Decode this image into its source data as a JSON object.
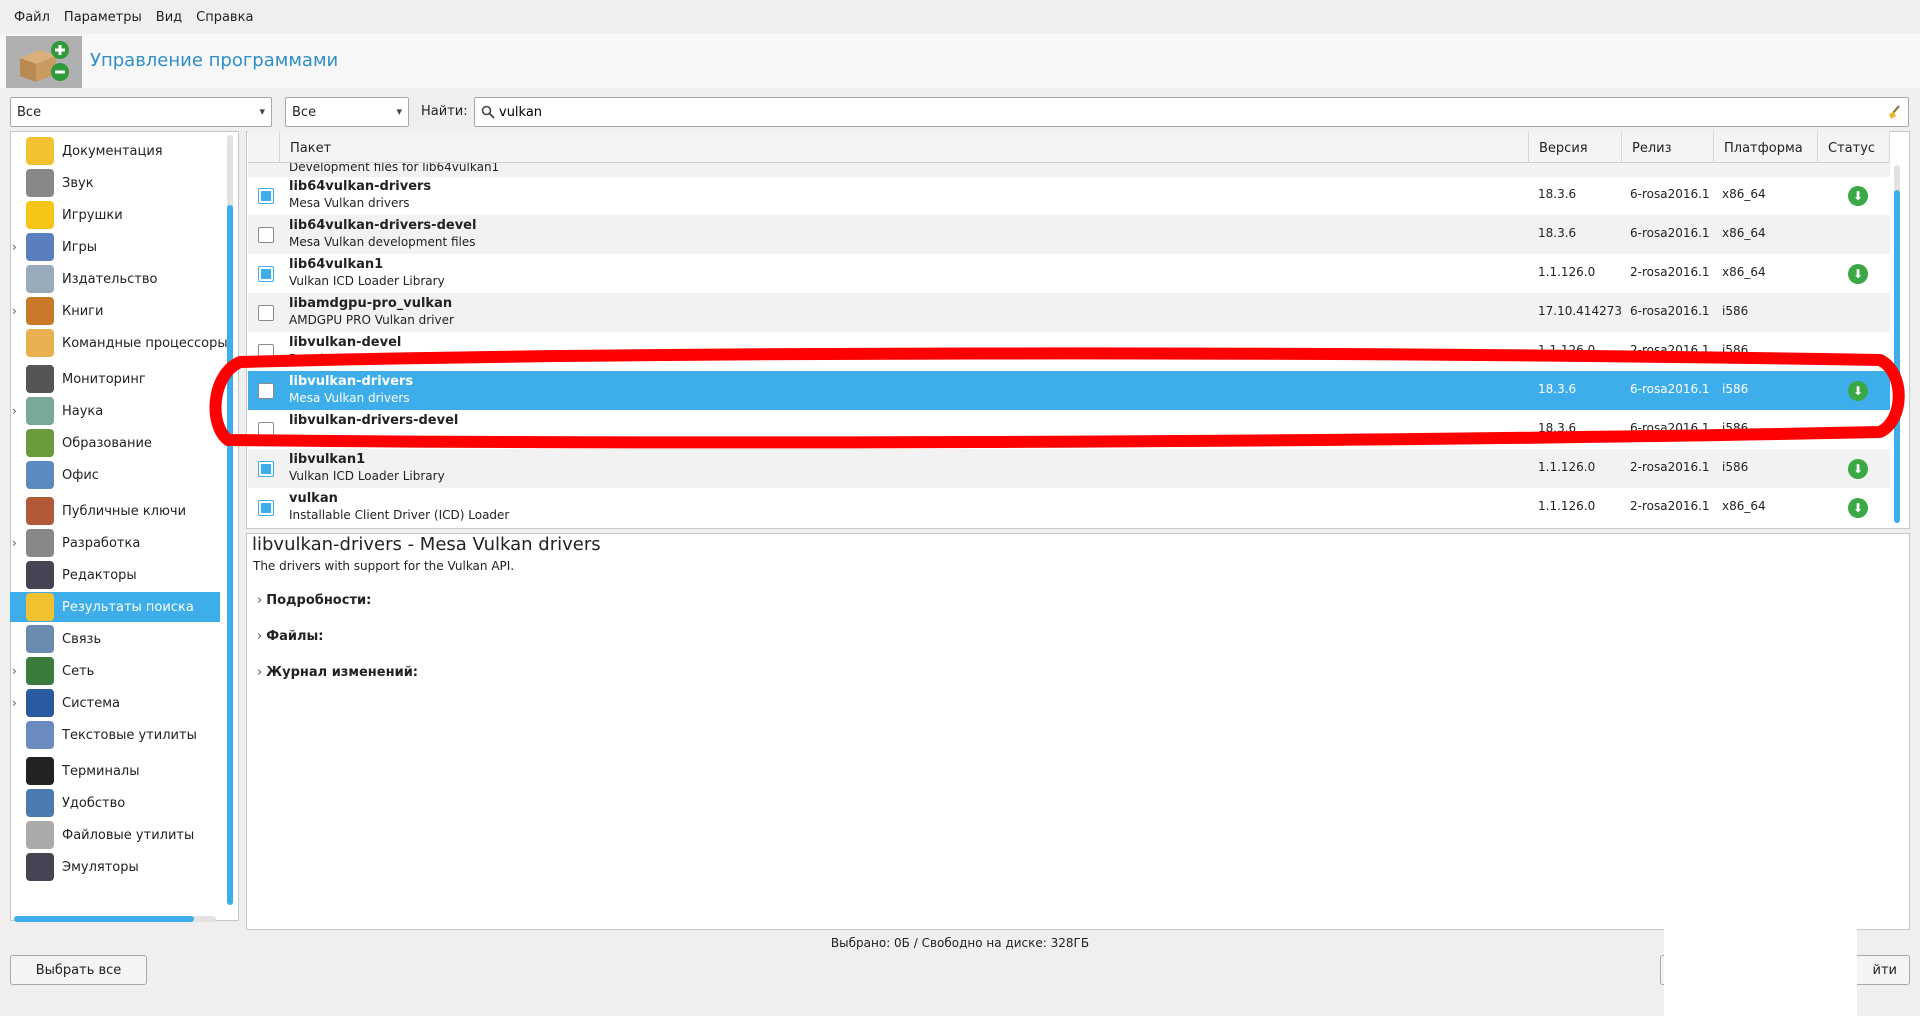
{
  "menu": {
    "file": "Файл",
    "params": "Параметры",
    "view": "Вид",
    "help": "Справка"
  },
  "banner": {
    "title": "Управление программами"
  },
  "filters": {
    "category_value": "Все",
    "status_value": "Все",
    "search_label": "Найти:",
    "search_value": "vulkan"
  },
  "categories": [
    {
      "label": "Документация",
      "expandable": false,
      "selected": false
    },
    {
      "label": "Звук",
      "expandable": false,
      "selected": false
    },
    {
      "label": "Игрушки",
      "expandable": false,
      "selected": false
    },
    {
      "label": "Игры",
      "expandable": true,
      "selected": false
    },
    {
      "label": "Издательство",
      "expandable": false,
      "selected": false
    },
    {
      "label": "Книги",
      "expandable": true,
      "selected": false
    },
    {
      "label": "Командные процессоры",
      "expandable": false,
      "selected": false
    },
    {
      "label": "Мониторинг",
      "expandable": false,
      "selected": false
    },
    {
      "label": "Наука",
      "expandable": true,
      "selected": false
    },
    {
      "label": "Образование",
      "expandable": false,
      "selected": false
    },
    {
      "label": "Офис",
      "expandable": false,
      "selected": false
    },
    {
      "label": "Публичные ключи",
      "expandable": false,
      "selected": false
    },
    {
      "label": "Разработка",
      "expandable": true,
      "selected": false
    },
    {
      "label": "Редакторы",
      "expandable": false,
      "selected": false
    },
    {
      "label": "Результаты поиска",
      "expandable": false,
      "selected": true
    },
    {
      "label": "Связь",
      "expandable": false,
      "selected": false
    },
    {
      "label": "Сеть",
      "expandable": true,
      "selected": false
    },
    {
      "label": "Система",
      "expandable": true,
      "selected": false
    },
    {
      "label": "Текстовые утилиты",
      "expandable": false,
      "selected": false
    },
    {
      "label": "Терминалы",
      "expandable": false,
      "selected": false
    },
    {
      "label": "Удобство",
      "expandable": false,
      "selected": false
    },
    {
      "label": "Файловые утилиты",
      "expandable": false,
      "selected": false
    },
    {
      "label": "Эмуляторы",
      "expandable": false,
      "selected": false
    }
  ],
  "table": {
    "headers": {
      "package": "Пакет",
      "version": "Версия",
      "release": "Релиз",
      "platform": "Платформа",
      "status": "Статус"
    },
    "partial_top_row": "Development files for lib64vulkan1",
    "rows": [
      {
        "name": "lib64vulkan-drivers",
        "desc": "Mesa Vulkan drivers",
        "version": "18.3.6",
        "release": "6-rosa2016.1",
        "platform": "x86_64",
        "checked": true,
        "installed": true,
        "selected": false
      },
      {
        "name": "lib64vulkan-drivers-devel",
        "desc": "Mesa Vulkan development files",
        "version": "18.3.6",
        "release": "6-rosa2016.1",
        "platform": "x86_64",
        "checked": false,
        "installed": false,
        "selected": false
      },
      {
        "name": "lib64vulkan1",
        "desc": "Vulkan ICD Loader Library",
        "version": "1.1.126.0",
        "release": "2-rosa2016.1",
        "platform": "x86_64",
        "checked": true,
        "installed": true,
        "selected": false
      },
      {
        "name": "libamdgpu-pro_vulkan",
        "desc": "AMDGPU PRO Vulkan driver",
        "version": "17.10.414273",
        "release": "6-rosa2016.1",
        "platform": "i586",
        "checked": false,
        "installed": false,
        "selected": false
      },
      {
        "name": "libvulkan-devel",
        "desc": "Development files for libvulkan1",
        "version": "1.1.126.0",
        "release": "2-rosa2016.1",
        "platform": "i586",
        "checked": false,
        "installed": false,
        "selected": false
      },
      {
        "name": "libvulkan-drivers",
        "desc": "Mesa Vulkan drivers",
        "version": "18.3.6",
        "release": "6-rosa2016.1",
        "platform": "i586",
        "checked": false,
        "installed": true,
        "selected": true
      },
      {
        "name": "libvulkan-drivers-devel",
        "desc": "",
        "version": "18.3.6",
        "release": "6-rosa2016.1",
        "platform": "i586",
        "checked": false,
        "installed": false,
        "selected": false
      },
      {
        "name": "libvulkan1",
        "desc": "Vulkan ICD Loader Library",
        "version": "1.1.126.0",
        "release": "2-rosa2016.1",
        "platform": "i586",
        "checked": true,
        "installed": true,
        "selected": false
      },
      {
        "name": "vulkan",
        "desc": "Installable Client Driver (ICD) Loader",
        "version": "1.1.126.0",
        "release": "2-rosa2016.1",
        "platform": "x86_64",
        "checked": true,
        "installed": true,
        "selected": false
      }
    ]
  },
  "details": {
    "title": "libvulkan-drivers - Mesa Vulkan drivers",
    "description": "The drivers with support for the Vulkan API.",
    "sections": [
      "Подробности:",
      "Файлы:",
      "Журнал изменений:"
    ]
  },
  "footer": {
    "status": "Выбрано: 0Б / Свободно на диске: 328ГБ",
    "select_all": "Выбрать все",
    "quit_partial": "йти"
  },
  "icons": {
    "clear": "broom-icon",
    "search": "magnifier-icon",
    "installed": "download-arrow-icon"
  },
  "colors": {
    "accent": "#3daee9",
    "title": "#2f8fc8",
    "installed": "#3aa845",
    "annotation": "#ff0000"
  }
}
